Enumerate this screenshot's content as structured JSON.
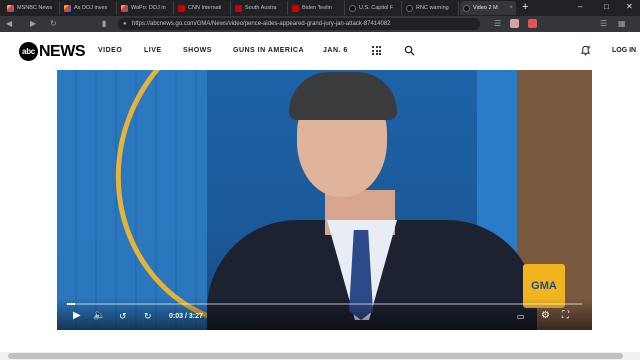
{
  "browser": {
    "tabs": [
      {
        "label": "MSNBC News",
        "favicon": "msnbc"
      },
      {
        "label": "As DOJ inves",
        "favicon": "msnbc"
      },
      {
        "label": "WaPo: DOJ in",
        "favicon": "msnbc"
      },
      {
        "label": "CNN Internati",
        "favicon": "cnn"
      },
      {
        "label": "South Austra",
        "favicon": "cnn"
      },
      {
        "label": "Biden 'feelin",
        "favicon": "cnn"
      },
      {
        "label": "U.S. Capitol F",
        "favicon": "abc"
      },
      {
        "label": "RNC warning",
        "favicon": "abc"
      },
      {
        "label": "Video 2 M",
        "favicon": "abc",
        "active": true
      }
    ],
    "url": "https://abcnews.go.com/GMA/News/video/pence-aides-appeared-grand-jury-jan-attack-87414082"
  },
  "site": {
    "logo_abc": "abc",
    "logo_news": "NEWS",
    "nav": [
      "VIDEO",
      "LIVE",
      "SHOWS",
      "GUNS IN AMERICA",
      "JAN. 6"
    ],
    "login": "LOG IN"
  },
  "player": {
    "current_time": "0:03",
    "duration": "/ 3:27",
    "badge": "GMA",
    "progress_fraction": 0.015
  },
  "colors": {
    "chrome_dark": "#202124",
    "chrome_mid": "#35363a",
    "accent_gma": "#f2b51f"
  }
}
